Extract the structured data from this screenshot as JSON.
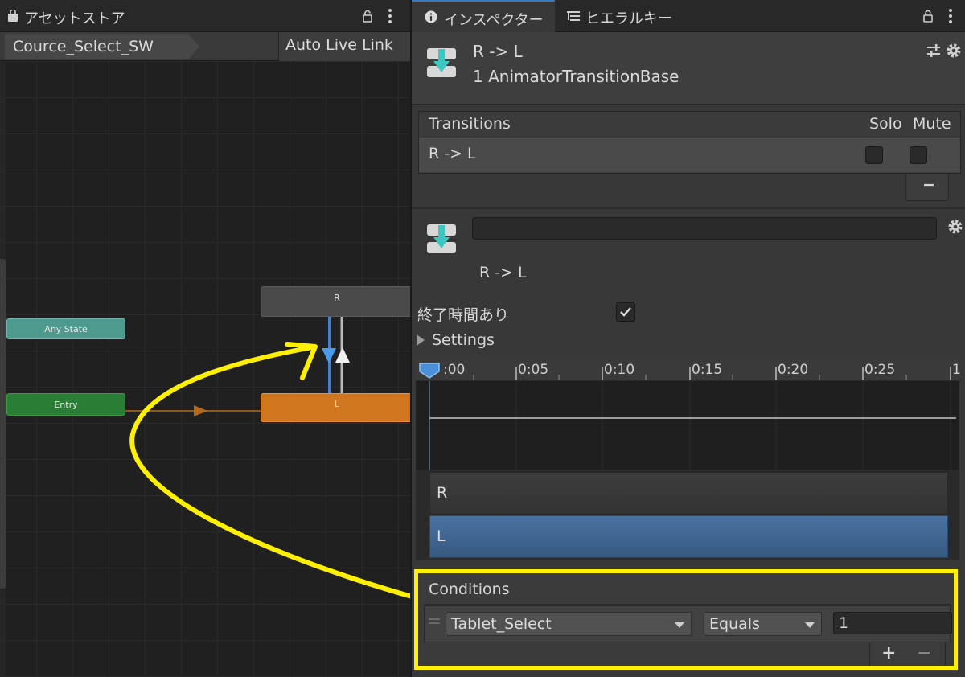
{
  "animator": {
    "tab_title": "アセットストア",
    "breadcrumb": "Cource_Select_SW",
    "live_link": "Auto Live Link",
    "nodes": {
      "any_state": "Any State",
      "entry": "Entry",
      "state_r": "R",
      "state_l": "L"
    }
  },
  "inspector": {
    "tabs": [
      {
        "label": "インスペクター",
        "icon": "info-icon"
      },
      {
        "label": "ヒエラルキー",
        "icon": "hierarchy-icon"
      }
    ],
    "header": {
      "title": "R -> L",
      "subtitle": "1 AnimatorTransitionBase"
    },
    "transitions": {
      "header": "Transitions",
      "solo_label": "Solo",
      "mute_label": "Mute",
      "rows": [
        {
          "label": "R -> L",
          "solo": false,
          "mute": false
        }
      ],
      "remove_label": "−"
    },
    "transition": {
      "name_value": "",
      "caption": "R -> L",
      "has_exit_time_label": "終了時間あり",
      "has_exit_time": true,
      "settings_label": "Settings"
    },
    "timeline": {
      "ticks": [
        ":00",
        "0:05",
        "0:10",
        "0:15",
        "0:20",
        "0:25",
        "1"
      ],
      "tracks": [
        "R",
        "L"
      ]
    },
    "conditions": {
      "header": "Conditions",
      "parameter": "Tablet_Select",
      "mode": "Equals",
      "value": "1",
      "add_label": "+",
      "remove_label": "−"
    },
    "colors": {
      "highlight": "#ffef00",
      "accent_blue": "#3a79bb"
    }
  }
}
